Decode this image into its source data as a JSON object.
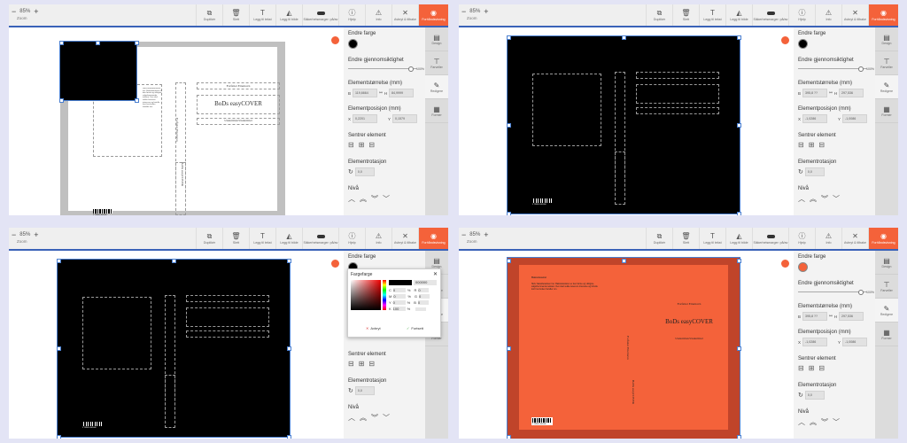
{
  "colors": {
    "accent": "#f4623a",
    "cover_black": "#000000",
    "cover_orange": "#f4623a",
    "bleed_gray": "#c0c0c0",
    "bleed_red": "#c0442a",
    "selection_blue": "#4a7fd0"
  },
  "toolbar": {
    "zoom_value": "85%",
    "zoom_label": "Zoom",
    "buttons": [
      {
        "label": "Duplikér",
        "icon": "duplicate-icon"
      },
      {
        "label": "Slett",
        "icon": "trash-icon"
      },
      {
        "label": "Legg til tekst",
        "icon": "text-icon"
      },
      {
        "label": "Legg til bilde",
        "icon": "image-icon"
      },
      {
        "label": "Sikkerhetsmarger: på/av",
        "icon": "toggle-icon"
      },
      {
        "label": "Hjelp",
        "icon": "info-icon"
      },
      {
        "label": "Info",
        "icon": "warning-icon"
      },
      {
        "label": "Avbryt & tilbake",
        "icon": "close-icon"
      },
      {
        "label": "Forhåndsvisning",
        "icon": "eye-icon"
      }
    ]
  },
  "properties": {
    "color_label": "Endre farge",
    "opacity_label": "Endre gjennomsiktighet",
    "opacity_value": "100%",
    "size_label": "Elementstørrelse (mm)",
    "size_w_label": "B",
    "size_h_label": "H",
    "position_label": "Elementposisjon (mm)",
    "position_x_label": "X",
    "position_y_label": "Y",
    "center_label": "Sentrer element",
    "rotation_label": "Elementrotasjon",
    "rotation_value": "0,0",
    "level_label": "Nivå"
  },
  "sidebar": {
    "items": [
      {
        "label": "Design",
        "icon": "page-icon"
      },
      {
        "label": "Farveller",
        "icon": "paint-roller-icon"
      },
      {
        "label": "Redigere",
        "icon": "edit-icon"
      },
      {
        "label": "Former",
        "icon": "shapes-icon"
      }
    ]
  },
  "panels": [
    {
      "size_w": "119,6664",
      "size_h": "84,9999",
      "pos_x": "0,2201",
      "pos_y": "0,1579"
    },
    {
      "size_w": "395,8 ??",
      "size_h": "297,536",
      "pos_x": "-1,0286",
      "pos_y": "-1,0086"
    },
    {
      "size_w": "",
      "size_h": "",
      "pos_x": "",
      "pos_y": ""
    },
    {
      "size_w": "395,8 ??",
      "size_h": "297,536",
      "pos_x": "-1,0286",
      "pos_y": "-1,0086"
    }
  ],
  "cover": {
    "author": "Forfatter Etternavn",
    "title": "BoDs easyCOVER",
    "subtitle": "Undertittel/Undertittel",
    "spine_author": "Forfatter Etternavn",
    "spine_title": "BoDs easyCOVER",
    "back_heading": "Baksidetekst",
    "back_text": "Skriv baksideteksten her. Baksideteksten er den første og viktigste salgsfremmende teksten. Den skal vekke leserens interesse og fortelle kort hva boken handler om.",
    "barcode_number": "9 783000 000000"
  },
  "color_picker": {
    "title": "Fargefarge",
    "hex_value": "000000",
    "rows": [
      {
        "l": "C",
        "v": "0",
        "u": "%",
        "l2": "R",
        "v2": "0"
      },
      {
        "l": "M",
        "v": "0",
        "u": "%",
        "l2": "G",
        "v2": "0"
      },
      {
        "l": "Y",
        "v": "0",
        "u": "%",
        "l2": "B",
        "v2": "0"
      },
      {
        "l": "K",
        "v": "100",
        "u": "%",
        "l2": "",
        "v2": ""
      }
    ],
    "cancel_label": "Avbryt",
    "confirm_label": "Fortsett"
  }
}
